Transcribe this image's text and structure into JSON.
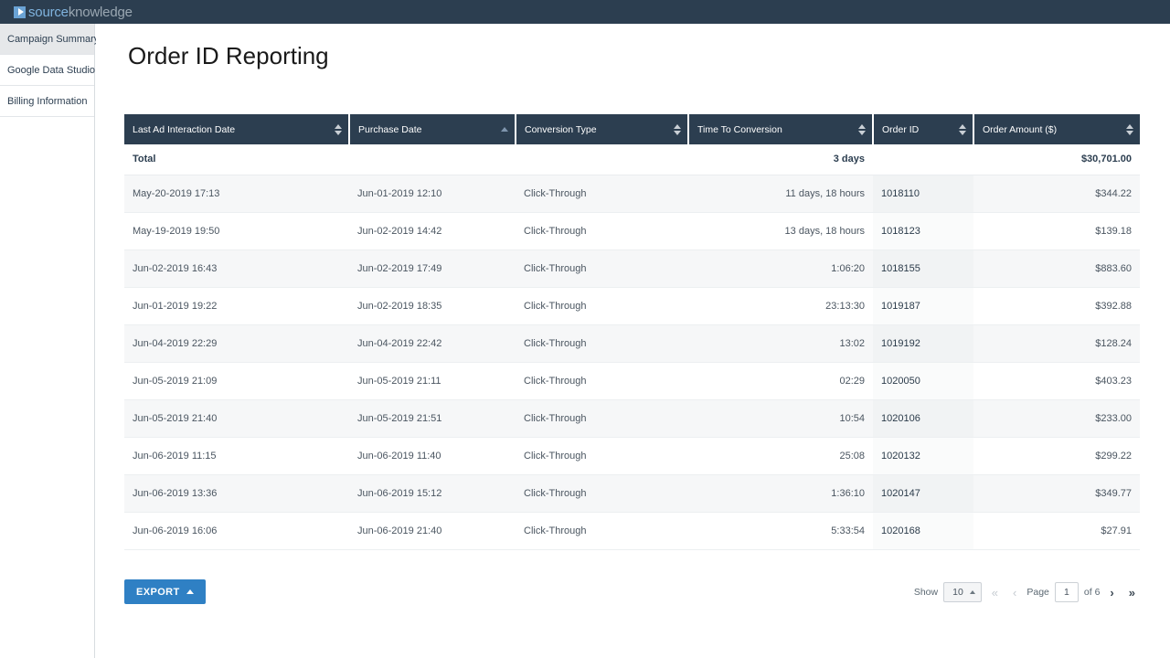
{
  "brand": {
    "mark": "play-icon",
    "name_a": "source",
    "name_b": "knowledge"
  },
  "sidebar": {
    "items": [
      {
        "label": "Campaign Summary",
        "active": true
      },
      {
        "label": "Google Data Studio",
        "active": false
      },
      {
        "label": "Billing Information",
        "active": false
      }
    ]
  },
  "page": {
    "title": "Order ID Reporting"
  },
  "table": {
    "columns": [
      {
        "label": "Last Ad Interaction Date",
        "sort": "none",
        "align": "left"
      },
      {
        "label": "Purchase Date",
        "sort": "asc",
        "align": "left"
      },
      {
        "label": "Conversion Type",
        "sort": "none",
        "align": "left"
      },
      {
        "label": "Time To Conversion",
        "sort": "none",
        "align": "right"
      },
      {
        "label": "Order ID",
        "sort": "none",
        "align": "left"
      },
      {
        "label": "Order Amount ($)",
        "sort": "none",
        "align": "right"
      }
    ],
    "total_row": {
      "label": "Total",
      "purchase_date": "",
      "conversion_type": "",
      "time_to_conversion": "3 days",
      "order_id": "",
      "order_amount": "$30,701.00"
    },
    "rows": [
      {
        "last_ad": "May-20-2019 17:13",
        "purchase": "Jun-01-2019 12:10",
        "type": "Click-Through",
        "ttc": "11 days, 18 hours",
        "order_id": "1018110",
        "amount": "$344.22"
      },
      {
        "last_ad": "May-19-2019 19:50",
        "purchase": "Jun-02-2019 14:42",
        "type": "Click-Through",
        "ttc": "13 days, 18 hours",
        "order_id": "1018123",
        "amount": "$139.18"
      },
      {
        "last_ad": "Jun-02-2019 16:43",
        "purchase": "Jun-02-2019 17:49",
        "type": "Click-Through",
        "ttc": "1:06:20",
        "order_id": "1018155",
        "amount": "$883.60"
      },
      {
        "last_ad": "Jun-01-2019 19:22",
        "purchase": "Jun-02-2019 18:35",
        "type": "Click-Through",
        "ttc": "23:13:30",
        "order_id": "1019187",
        "amount": "$392.88"
      },
      {
        "last_ad": "Jun-04-2019 22:29",
        "purchase": "Jun-04-2019 22:42",
        "type": "Click-Through",
        "ttc": "13:02",
        "order_id": "1019192",
        "amount": "$128.24"
      },
      {
        "last_ad": "Jun-05-2019 21:09",
        "purchase": "Jun-05-2019 21:11",
        "type": "Click-Through",
        "ttc": "02:29",
        "order_id": "1020050",
        "amount": "$403.23"
      },
      {
        "last_ad": "Jun-05-2019 21:40",
        "purchase": "Jun-05-2019 21:51",
        "type": "Click-Through",
        "ttc": "10:54",
        "order_id": "1020106",
        "amount": "$233.00"
      },
      {
        "last_ad": "Jun-06-2019 11:15",
        "purchase": "Jun-06-2019 11:40",
        "type": "Click-Through",
        "ttc": "25:08",
        "order_id": "1020132",
        "amount": "$299.22"
      },
      {
        "last_ad": "Jun-06-2019 13:36",
        "purchase": "Jun-06-2019 15:12",
        "type": "Click-Through",
        "ttc": "1:36:10",
        "order_id": "1020147",
        "amount": "$349.77"
      },
      {
        "last_ad": "Jun-06-2019 16:06",
        "purchase": "Jun-06-2019 21:40",
        "type": "Click-Through",
        "ttc": "5:33:54",
        "order_id": "1020168",
        "amount": "$27.91"
      }
    ]
  },
  "footer": {
    "export_label": "EXPORT",
    "show_label": "Show",
    "page_size": "10",
    "page_label": "Page",
    "page_value": "1",
    "of_label": "of 6",
    "first_arrow": "«",
    "prev_arrow": "‹",
    "next_arrow": "›",
    "last_arrow": "»"
  },
  "colors": {
    "header_bg": "#2c3e50",
    "accent_blue": "#2f80c4",
    "logo_blue": "#7fb3de",
    "row_alt": "#f6f7f8"
  }
}
